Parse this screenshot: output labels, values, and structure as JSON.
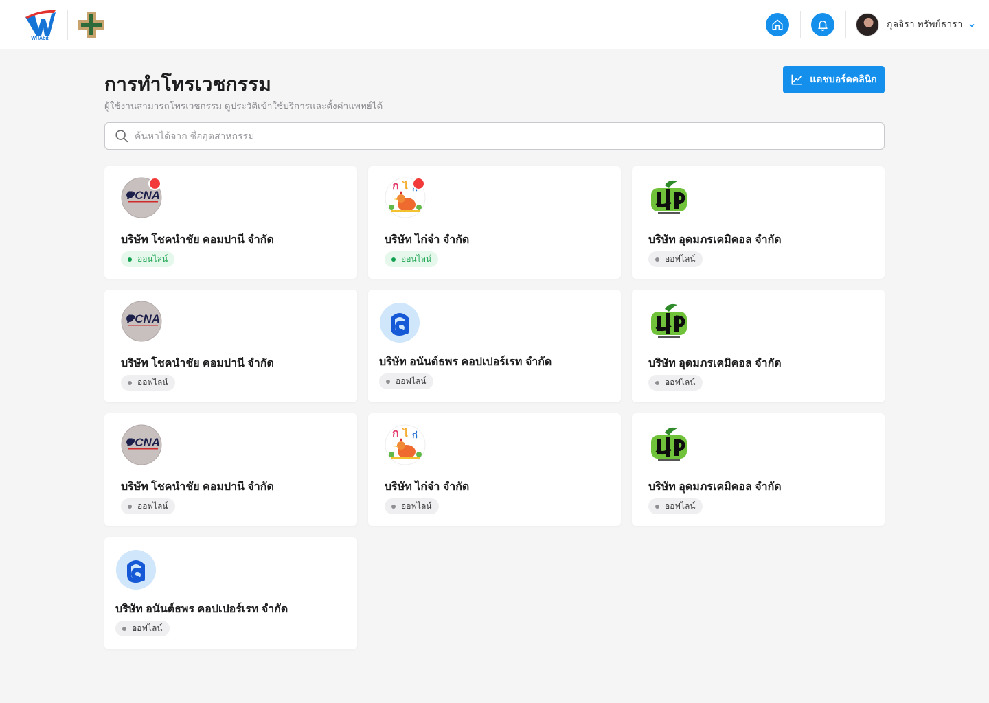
{
  "header": {
    "brand": "WHAbit",
    "user": {
      "name": "กุลจิรา ทรัพย์ธารา"
    }
  },
  "page": {
    "title": "การทำโทรเวชกรรม",
    "subtitle": "ผู้ใช้งานสามารถโทรเวชกรรม ดูประวัติเข้าใช้บริการและตั้งค่าแพทย์ได้",
    "dashboard_button": "แดชบอร์ดคลินิก"
  },
  "search": {
    "placeholder": "ค้นหาได้จาก ชื่ออุตสาหกรรม",
    "value": ""
  },
  "cards": [
    {
      "name": "บริษัท โชคนำชัย คอมปานี จำกัด",
      "logo": "pcna-logo",
      "status": "ออนไลน์",
      "online": true,
      "notification": true
    },
    {
      "name": "บริษัท ไก่จ๋า จำกัด",
      "logo": "kaija-logo",
      "status": "ออนไลน์",
      "online": true,
      "notification": true
    },
    {
      "name": "บริษัท อุดมภรเคมิคอล จำกัด",
      "logo": "udomporn-logo",
      "status": "ออฟไลน์",
      "online": false,
      "notification": false
    },
    {
      "name": "บริษัท โชคนำชัย คอมปานี จำกัด",
      "logo": "pcna-logo",
      "status": "ออฟไลน์",
      "online": false,
      "notification": false
    },
    {
      "name": "บริษัท อนันต์ธพร คอปเปอร์เรท จำกัด",
      "logo": "anan-logo",
      "status": "ออฟไลน์",
      "online": false,
      "notification": false
    },
    {
      "name": "บริษัท อุดมภรเคมิคอล จำกัด",
      "logo": "udomporn-logo",
      "status": "ออฟไลน์",
      "online": false,
      "notification": false
    },
    {
      "name": "บริษัท โชคนำชัย คอมปานี จำกัด",
      "logo": "pcna-logo",
      "status": "ออฟไลน์",
      "online": false,
      "notification": false
    },
    {
      "name": "บริษัท ไก่จ๋า จำกัด",
      "logo": "kaija-logo",
      "status": "ออฟไลน์",
      "online": false,
      "notification": false
    },
    {
      "name": "บริษัท อุดมภรเคมิคอล จำกัด",
      "logo": "udomporn-logo",
      "status": "ออฟไลน์",
      "online": false,
      "notification": false
    },
    {
      "name": "บริษัท อนันต์ธพร คอปเปอร์เรท จำกัด",
      "logo": "anan-logo",
      "status": "ออฟไลน์",
      "online": false,
      "notification": false
    }
  ],
  "colors": {
    "accent": "#1490ec",
    "online": "#12a150",
    "notification": "#f23a3a"
  }
}
